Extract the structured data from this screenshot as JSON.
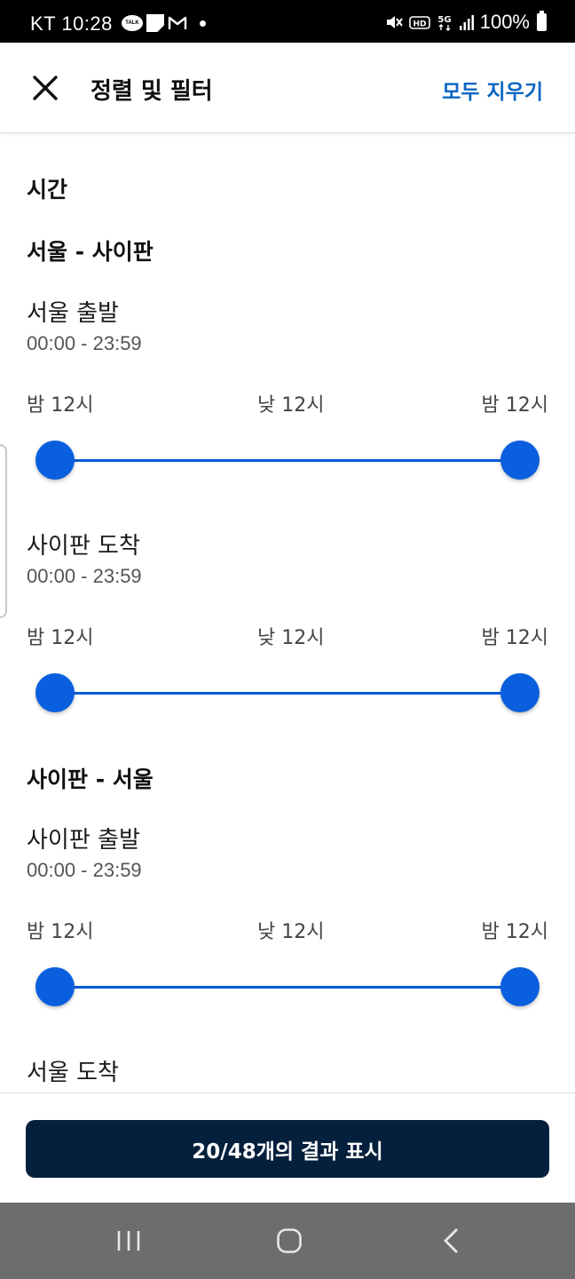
{
  "status_bar": {
    "carrier": "KT",
    "time": "10:28",
    "talk_badge": "TALK",
    "network": "5G",
    "hd": "HD",
    "battery": "100%"
  },
  "header": {
    "title": "정렬 및 필터",
    "clear_all": "모두 지우기"
  },
  "section": {
    "title": "시간"
  },
  "routes": [
    {
      "title": "서울 - 사이판",
      "blocks": [
        {
          "label": "서울 출발",
          "range": "00:00 - 23:59",
          "ticks": [
            "밤 12시",
            "낮 12시",
            "밤 12시"
          ],
          "slider": {
            "start_fraction": 0.0,
            "end_fraction": 1.0
          }
        },
        {
          "label": "사이판 도착",
          "range": "00:00 - 23:59",
          "ticks": [
            "밤 12시",
            "낮 12시",
            "밤 12시"
          ],
          "slider": {
            "start_fraction": 0.0,
            "end_fraction": 1.0
          }
        }
      ]
    },
    {
      "title": "사이판 - 서울",
      "blocks": [
        {
          "label": "사이판 출발",
          "range": "00:00 - 23:59",
          "ticks": [
            "밤 12시",
            "낮 12시",
            "밤 12시"
          ],
          "slider": {
            "start_fraction": 0.0,
            "end_fraction": 1.0
          }
        },
        {
          "label": "서울 도착"
        }
      ]
    }
  ],
  "footer": {
    "show_results": "20/48개의 결과 표시"
  },
  "colors": {
    "accent": "#0a5fde",
    "link": "#0a66c2",
    "primary_button": "#05203c",
    "nav_bar": "#6d6d6d"
  }
}
